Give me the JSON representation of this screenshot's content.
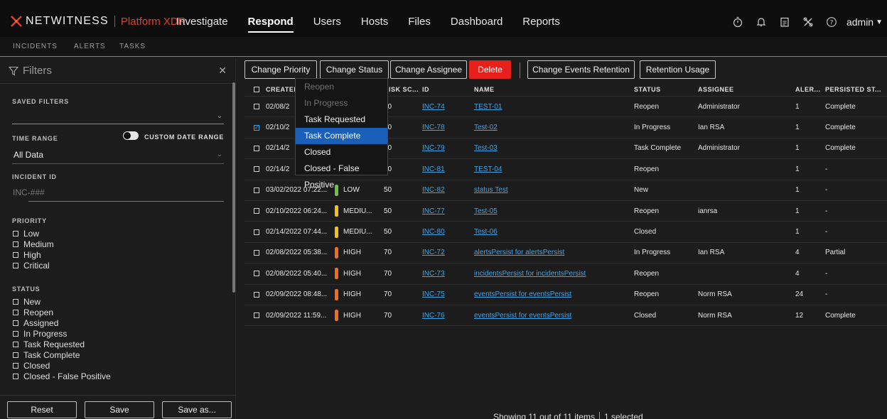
{
  "topnav": {
    "brand": "NETWITNESS",
    "platform": "Platform XDR",
    "items": [
      "Investigate",
      "Respond",
      "Users",
      "Hosts",
      "Files",
      "Dashboard",
      "Reports"
    ],
    "active": "Respond",
    "user": "admin"
  },
  "subnav": {
    "tabs": [
      "INCIDENTS",
      "ALERTS",
      "TASKS"
    ],
    "active": "INCIDENTS"
  },
  "filters": {
    "title": "Filters",
    "saved_filters": "SAVED FILTERS",
    "time_range": "TIME RANGE",
    "custom_date_range": "CUSTOM DATE RANGE",
    "time_range_value": "All Data",
    "incident_id": "INCIDENT ID",
    "incident_id_placeholder": "INC-###",
    "priority": "PRIORITY",
    "priority_options": [
      "Low",
      "Medium",
      "High",
      "Critical"
    ],
    "status": "STATUS",
    "status_options": [
      "New",
      "Reopen",
      "Assigned",
      "In Progress",
      "Task Requested",
      "Task Complete",
      "Closed",
      "Closed - False Positive"
    ],
    "reset": "Reset",
    "save": "Save",
    "save_as": "Save as..."
  },
  "toolbar": {
    "change_priority": "Change Priority",
    "change_status": "Change Status",
    "change_assignee": "Change Assignee",
    "delete": "Delete",
    "change_events_retention": "Change Events Retention",
    "retention_usage": "Retention Usage"
  },
  "grid": {
    "headers": {
      "created": "CREATED",
      "risk_score": "RISK SC...",
      "id": "ID",
      "name": "NAME",
      "status": "STATUS",
      "assignee": "ASSIGNEE",
      "alerts": "ALER...",
      "persisted": "PERSISTED ST..."
    },
    "rows": [
      {
        "created": "02/08/2",
        "priority": "",
        "priority_color": "",
        "risk": "50",
        "id": "INC-74",
        "name": "TEST-01",
        "status": "Reopen",
        "assignee": "Administrator",
        "alerts": "1",
        "persisted": "Complete",
        "checked": false
      },
      {
        "created": "02/10/2",
        "priority": "",
        "priority_color": "",
        "risk": "70",
        "id": "INC-78",
        "name": "Test-02",
        "status": "In Progress",
        "assignee": "Ian RSA",
        "alerts": "1",
        "persisted": "Complete",
        "checked": true
      },
      {
        "created": "02/14/2",
        "priority": "",
        "priority_color": "",
        "risk": "50",
        "id": "INC-79",
        "name": "Test-03",
        "status": "Task Complete",
        "assignee": "Administrator",
        "alerts": "1",
        "persisted": "Complete",
        "checked": false
      },
      {
        "created": "02/14/2",
        "priority": "",
        "priority_color": "",
        "risk": "50",
        "id": "INC-81",
        "name": "TEST-04",
        "status": "Reopen",
        "assignee": "",
        "alerts": "1",
        "persisted": "-",
        "checked": false
      },
      {
        "created": "03/02/2022 07:22...",
        "priority": "LOW",
        "priority_color": "#6cc04a",
        "risk": "50",
        "id": "INC-82",
        "name": "status Test",
        "status": "New",
        "assignee": "",
        "alerts": "1",
        "persisted": "-",
        "checked": false
      },
      {
        "created": "02/10/2022 06:24...",
        "priority": "MEDIU...",
        "priority_color": "#f2c014",
        "risk": "50",
        "id": "INC-77",
        "name": "Test-05",
        "status": "Reopen",
        "assignee": "ianrsa",
        "alerts": "1",
        "persisted": "-",
        "checked": false
      },
      {
        "created": "02/14/2022 07:44...",
        "priority": "MEDIU...",
        "priority_color": "#f2c014",
        "risk": "50",
        "id": "INC-80",
        "name": "Test-06",
        "status": "Closed",
        "assignee": "",
        "alerts": "1",
        "persisted": "-",
        "checked": false
      },
      {
        "created": "02/08/2022 05:38...",
        "priority": "HIGH",
        "priority_color": "#f26a1b",
        "risk": "70",
        "id": "INC-72",
        "name": "alertsPersist for alertsPersist",
        "status": "In Progress",
        "assignee": "Ian RSA",
        "alerts": "4",
        "persisted": "Partial",
        "checked": false
      },
      {
        "created": "02/08/2022 05:40...",
        "priority": "HIGH",
        "priority_color": "#f26a1b",
        "risk": "70",
        "id": "INC-73",
        "name": "incidentsPersist for incidentsPersist",
        "status": "Reopen",
        "assignee": "",
        "alerts": "4",
        "persisted": "-",
        "checked": false
      },
      {
        "created": "02/09/2022 08:48...",
        "priority": "HIGH",
        "priority_color": "#f26a1b",
        "risk": "70",
        "id": "INC-75",
        "name": "eventsPersist for eventsPersist",
        "status": "Reopen",
        "assignee": "Norm RSA",
        "alerts": "24",
        "persisted": "-",
        "checked": false
      },
      {
        "created": "02/09/2022 11:59...",
        "priority": "HIGH",
        "priority_color": "#f26a1b",
        "risk": "70",
        "id": "INC-76",
        "name": "eventsPersist for eventsPersist",
        "status": "Closed",
        "assignee": "Norm RSA",
        "alerts": "12",
        "persisted": "Complete",
        "checked": false
      }
    ]
  },
  "status_menu": {
    "options": [
      {
        "label": "Reopen",
        "state": "disabled"
      },
      {
        "label": "In Progress",
        "state": "disabled"
      },
      {
        "label": "Task Requested",
        "state": "normal"
      },
      {
        "label": "Task Complete",
        "state": "selected"
      },
      {
        "label": "Closed",
        "state": "normal"
      },
      {
        "label": "Closed - False Positive",
        "state": "normal"
      }
    ]
  },
  "footer": {
    "showing": "Showing 11 out of 11 items",
    "selected": "1 selected"
  },
  "colors": {
    "accent": "#2d9fd8",
    "link": "#3ea4e8",
    "danger": "#e8201c",
    "brand": "#e0412f",
    "menu_selected": "#1a5fb8"
  },
  "icons": [
    "filter-icon",
    "close-icon",
    "stopwatch-icon",
    "bell-icon",
    "clipboard-icon",
    "tools-icon",
    "help-icon"
  ]
}
